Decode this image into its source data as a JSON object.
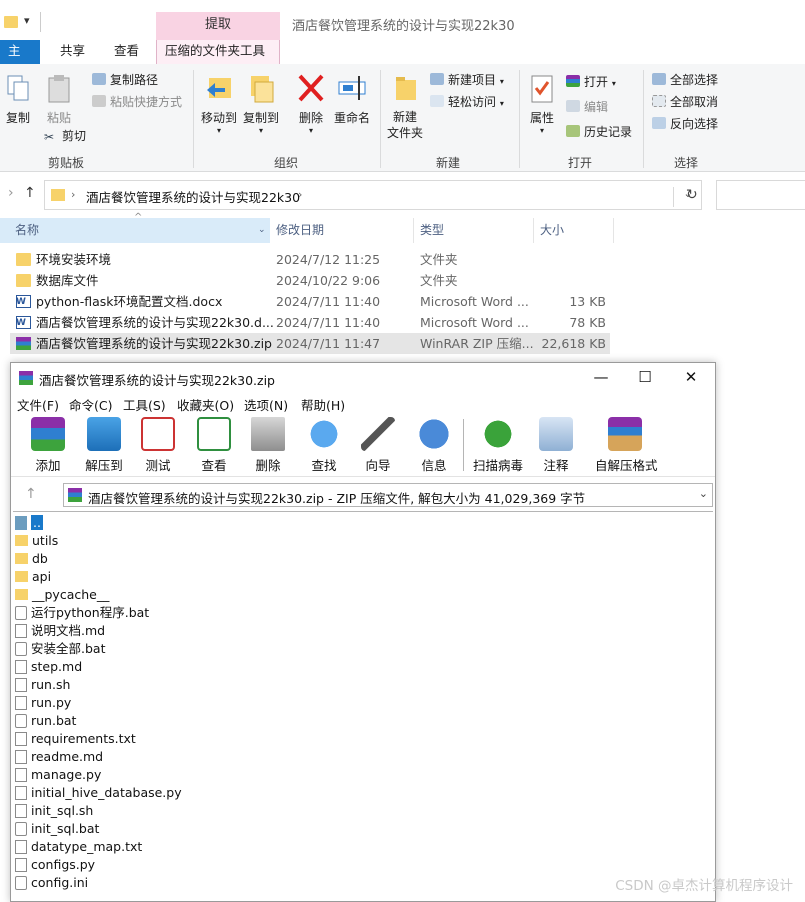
{
  "explorer": {
    "window_title": "酒店餐饮管理系统的设计与实现22k30",
    "context_tab": "提取",
    "tabs": [
      "主页",
      "共享",
      "查看",
      "压缩的文件夹工具"
    ],
    "ribbon": {
      "clipboard": {
        "label": "剪贴板",
        "copy": "复制",
        "paste": "粘贴",
        "copy_path": "复制路径",
        "paste_shortcut": "粘贴快捷方式",
        "cut": "剪切"
      },
      "organize": {
        "label": "组织",
        "move_to": "移动到",
        "copy_to": "复制到",
        "delete": "删除",
        "rename": "重命名"
      },
      "new": {
        "label": "新建",
        "new_item": "新建项目",
        "easy_access": "轻松访问",
        "new_folder": "新建\n文件夹"
      },
      "open": {
        "label": "打开",
        "properties": "属性",
        "open": "打开",
        "edit": "编辑",
        "history": "历史记录"
      },
      "select": {
        "label": "选择",
        "select_all": "全部选择",
        "select_none": "全部取消",
        "invert": "反向选择"
      }
    },
    "address_path": "酒店餐饮管理系统的设计与实现22k30",
    "columns": [
      "名称",
      "修改日期",
      "类型",
      "大小"
    ],
    "files": [
      {
        "icon": "folder-icon",
        "name": "环境安装环境",
        "date": "2024/7/12 11:25",
        "type": "文件夹",
        "size": ""
      },
      {
        "icon": "folder-icon",
        "name": "数据库文件",
        "date": "2024/10/22 9:06",
        "type": "文件夹",
        "size": ""
      },
      {
        "icon": "word-doc-icon",
        "name": "python-flask环境配置文档.docx",
        "date": "2024/7/11 11:40",
        "type": "Microsoft Word ...",
        "size": "13 KB"
      },
      {
        "icon": "word-doc-icon",
        "name": "酒店餐饮管理系统的设计与实现22k30.d...",
        "date": "2024/7/11 11:40",
        "type": "Microsoft Word ...",
        "size": "78 KB"
      },
      {
        "icon": "winrar-archive-icon",
        "name": "酒店餐饮管理系统的设计与实现22k30.zip",
        "date": "2024/7/11 11:47",
        "type": "WinRAR ZIP 压缩...",
        "size": "22,618 KB"
      }
    ]
  },
  "winrar": {
    "title": "酒店餐饮管理系统的设计与实现22k30.zip",
    "controls": [
      "—",
      "☐",
      "✕"
    ],
    "menu": [
      "文件(F)",
      "命令(C)",
      "工具(S)",
      "收藏夹(O)",
      "选项(N)",
      "帮助(H)"
    ],
    "toolbar": [
      "添加",
      "解压到",
      "测试",
      "查看",
      "删除",
      "查找",
      "向导",
      "信息",
      "扫描病毒",
      "注释",
      "自解压格式"
    ],
    "path": "酒店餐饮管理系统的设计与实现22k30.zip - ZIP 压缩文件, 解包大小为 41,029,369 字节",
    "items": [
      {
        "type": "updir",
        "name": ".."
      },
      {
        "type": "folder",
        "name": "utils"
      },
      {
        "type": "folder",
        "name": "db"
      },
      {
        "type": "folder",
        "name": "api"
      },
      {
        "type": "folder",
        "name": "__pycache__"
      },
      {
        "type": "bat",
        "name": "运行python程序.bat"
      },
      {
        "type": "file",
        "name": "说明文档.md"
      },
      {
        "type": "bat",
        "name": "安装全部.bat"
      },
      {
        "type": "file",
        "name": "step.md"
      },
      {
        "type": "file",
        "name": "run.sh"
      },
      {
        "type": "file",
        "name": "run.py"
      },
      {
        "type": "bat",
        "name": "run.bat"
      },
      {
        "type": "file",
        "name": "requirements.txt"
      },
      {
        "type": "file",
        "name": "readme.md"
      },
      {
        "type": "file",
        "name": "manage.py"
      },
      {
        "type": "file",
        "name": "initial_hive_database.py"
      },
      {
        "type": "file",
        "name": "init_sql.sh"
      },
      {
        "type": "bat",
        "name": "init_sql.bat"
      },
      {
        "type": "file",
        "name": "datatype_map.txt"
      },
      {
        "type": "file",
        "name": "configs.py"
      },
      {
        "type": "bat",
        "name": "config.ini"
      }
    ]
  },
  "watermark": "CSDN @卓杰计算机程序设计"
}
